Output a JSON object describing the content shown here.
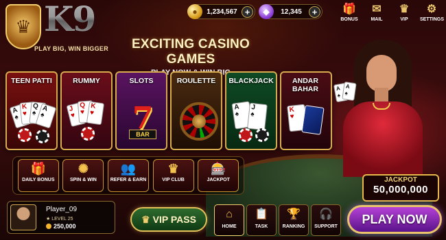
{
  "brand": {
    "logo_text": "K9",
    "tagline": "PLAY BIG, WIN BIGGER",
    "emblem_icon": "lion-crest-icon"
  },
  "currency": {
    "coins": {
      "value": "1,234,567",
      "icon": "gold-coin-icon"
    },
    "gems": {
      "value": "12,345",
      "icon": "diamond-icon"
    }
  },
  "top_menu": [
    {
      "label": "BONUS",
      "icon": "gift-icon"
    },
    {
      "label": "MAIL",
      "icon": "mail-icon"
    },
    {
      "label": "VIP",
      "icon": "crown-icon"
    },
    {
      "label": "SETTINGS",
      "icon": "gear-icon"
    }
  ],
  "headline": {
    "title": "EXCITING CASINO GAMES",
    "subtitle": "PLAY NOW & WIN BIG"
  },
  "games": [
    {
      "label": "TEEN PATTI"
    },
    {
      "label": "RUMMY"
    },
    {
      "label": "SLOTS"
    },
    {
      "label": "ROULETTE"
    },
    {
      "label": "BLACKJACK"
    },
    {
      "label": "ANDAR BAHAR"
    }
  ],
  "features": [
    {
      "label": "DAILY BONUS",
      "icon": "gift-icon"
    },
    {
      "label": "SPIN & WIN",
      "icon": "wheel-icon"
    },
    {
      "label": "REFER & EARN",
      "icon": "people-icon"
    },
    {
      "label": "VIP CLUB",
      "icon": "crown-icon"
    },
    {
      "label": "JACKPOT",
      "icon": "slot-machine-icon"
    }
  ],
  "player": {
    "name": "Player_09",
    "level": "LEVEL 25",
    "coins": "250,000"
  },
  "vip_pass": {
    "label": "VIP PASS"
  },
  "nav": [
    {
      "label": "HOME",
      "icon": "home-icon"
    },
    {
      "label": "TASK",
      "icon": "clipboard-icon"
    },
    {
      "label": "RANKING",
      "icon": "trophy-icon"
    },
    {
      "label": "SUPPORT",
      "icon": "headset-icon"
    }
  ],
  "jackpot": {
    "label": "JACKPOT",
    "value": "50,000,000"
  },
  "play_button": {
    "label": "PLAY NOW"
  },
  "colors": {
    "gold": "#e6b84a",
    "play_purple": "#8a2ad0",
    "vip_green": "#1f5a22"
  }
}
